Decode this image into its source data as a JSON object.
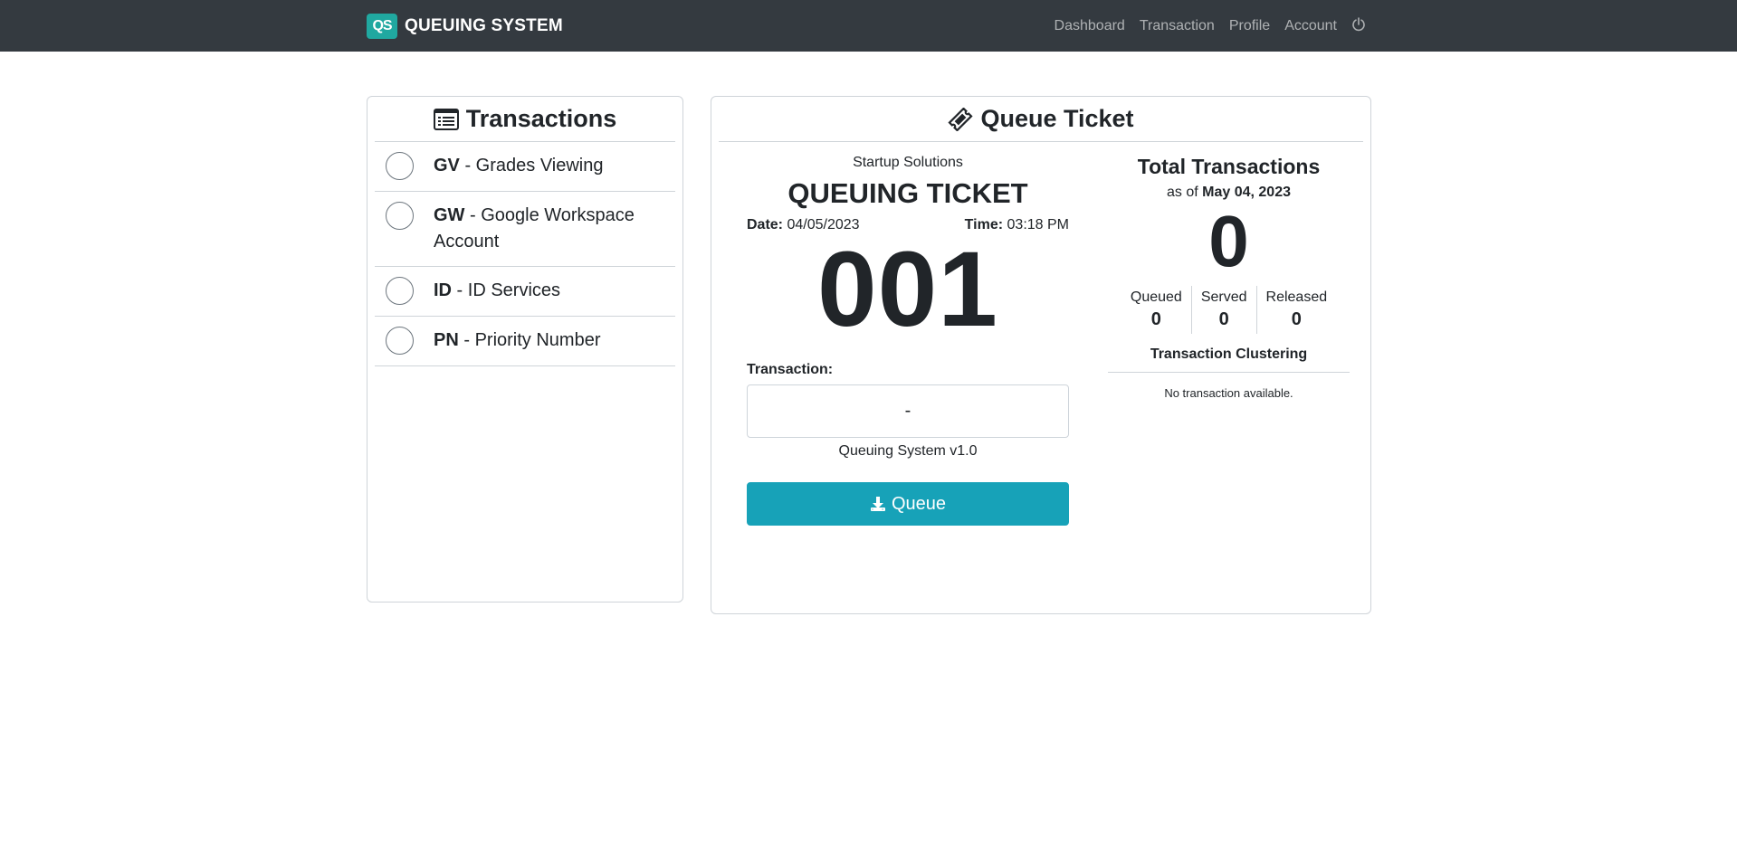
{
  "navbar": {
    "logo_text": "QS",
    "brand": "QUEUING SYSTEM",
    "links": [
      "Dashboard",
      "Transaction",
      "Profile",
      "Account"
    ],
    "power_icon": "power-icon"
  },
  "transactions": {
    "title": "Transactions",
    "icon": "list-icon",
    "items": [
      {
        "code": "GV",
        "name": " - Grades Viewing"
      },
      {
        "code": "GW",
        "name": " - Google Workspace Account"
      },
      {
        "code": "ID",
        "name": " - ID Services"
      },
      {
        "code": "PN",
        "name": " - Priority Number"
      }
    ]
  },
  "queue_ticket": {
    "title": "Queue Ticket",
    "icon": "ticket-icon",
    "company": "Startup Solutions",
    "ticket_title": "QUEUING TICKET",
    "date_label": "Date:",
    "date_value": "04/05/2023",
    "time_label": "Time:",
    "time_value": "03:18 PM",
    "number": "001",
    "transaction_label": "Transaction:",
    "transaction_value": "-",
    "version": "Queuing System v1.0",
    "button_label": "Queue",
    "button_icon": "download-icon"
  },
  "stats": {
    "title": "Total Transactions",
    "as_of_prefix": "as of",
    "as_of_date": "May 04, 2023",
    "total": "0",
    "queued_label": "Queued",
    "queued_value": "0",
    "served_label": "Served",
    "served_value": "0",
    "released_label": "Released",
    "released_value": "0",
    "clustering_title": "Transaction Clustering",
    "clustering_empty": "No transaction available."
  },
  "colors": {
    "navbar": "#343a40",
    "accent": "#17a2b8",
    "logo": "#20a8a0"
  }
}
